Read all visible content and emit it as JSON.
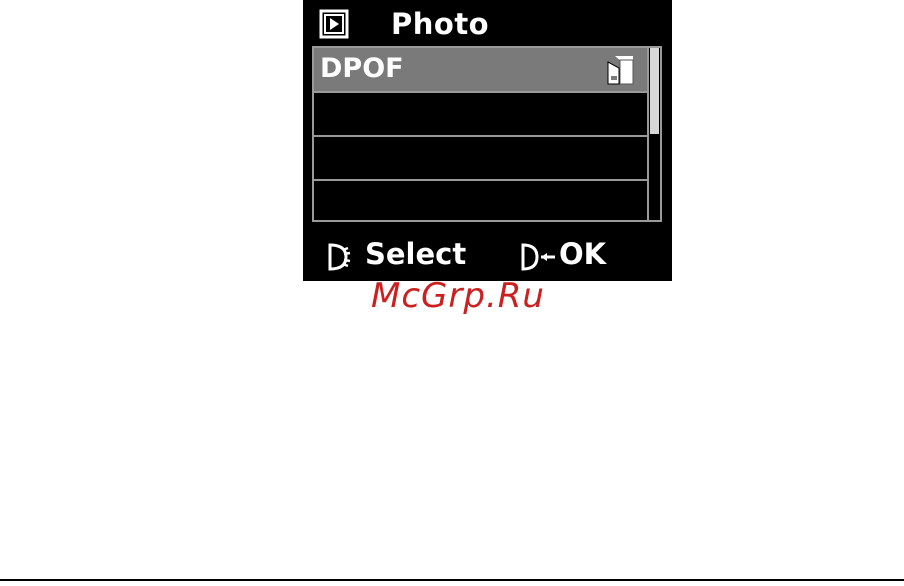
{
  "header": {
    "title": "Photo",
    "icon": "play-icon"
  },
  "menu": {
    "items": [
      {
        "label": "DPOF",
        "selected": true,
        "icon": "memory-card-icon"
      },
      {
        "label": "",
        "selected": false
      },
      {
        "label": "",
        "selected": false
      },
      {
        "label": "",
        "selected": false
      }
    ],
    "scroll_position": 0.0
  },
  "footer": {
    "select_icon": "dial-icon",
    "select_label": "Select",
    "ok_icon": "shutter-ok-icon",
    "ok_label": "OK"
  },
  "watermark": {
    "text": "McGrp.Ru",
    "color": "#cc2020"
  },
  "colors": {
    "screen_bg": "#000000",
    "selected_bg": "#7a7a7a",
    "border": "#9a9a9a",
    "text": "#ffffff"
  }
}
